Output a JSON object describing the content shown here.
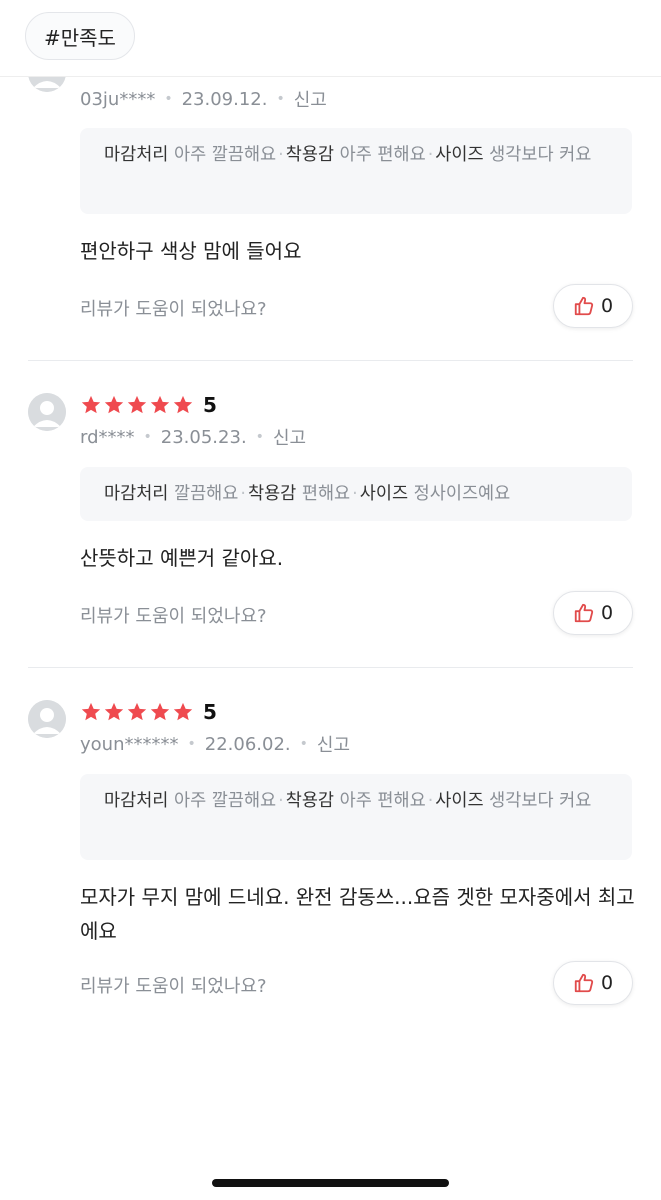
{
  "filter_chip": "#만족도",
  "colors": {
    "star": "#ef4a4f",
    "like_icon": "#e14b4b"
  },
  "reviews": [
    {
      "rating": "",
      "user": "03ju****",
      "date": "23.09.12.",
      "report": "신고",
      "attributes": [
        {
          "key": "마감처리",
          "value": "아주 깔끔해요"
        },
        {
          "key": "착용감",
          "value": "아주 편해요"
        },
        {
          "key": "사이즈",
          "value": "생각보다 커요"
        }
      ],
      "text": "편안하구 색상 맘에 들어요",
      "helpful_label": "리뷰가 도움이 되었나요?",
      "likes": "0"
    },
    {
      "rating": "5",
      "user": "rd****",
      "date": "23.05.23.",
      "report": "신고",
      "attributes": [
        {
          "key": "마감처리",
          "value": "깔끔해요"
        },
        {
          "key": "착용감",
          "value": "편해요"
        },
        {
          "key": "사이즈",
          "value": "정사이즈예요"
        }
      ],
      "text": "산뜻하고 예쁜거 같아요.",
      "helpful_label": "리뷰가 도움이 되었나요?",
      "likes": "0"
    },
    {
      "rating": "5",
      "user": "youn******",
      "date": "22.06.02.",
      "report": "신고",
      "attributes": [
        {
          "key": "마감처리",
          "value": "아주 깔끔해요"
        },
        {
          "key": "착용감",
          "value": "아주 편해요"
        },
        {
          "key": "사이즈",
          "value": "생각보다 커요"
        }
      ],
      "text": "모자가 무지 맘에 드네요. 완전 감동쓰...요즘 겟한 모자중에서 최고에요",
      "helpful_label": "리뷰가 도움이 되었나요?",
      "likes": "0"
    }
  ]
}
